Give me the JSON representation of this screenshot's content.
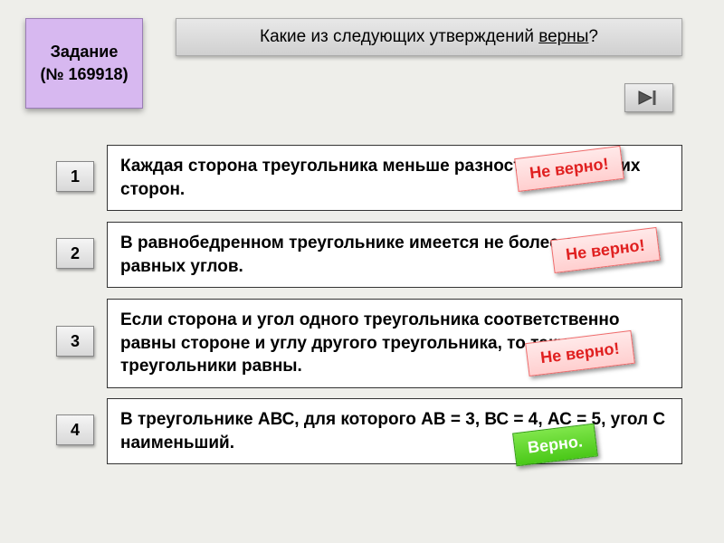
{
  "task": {
    "label": "Задание",
    "number": "(№ 169918)"
  },
  "question": {
    "prefix": "Какие из следующих утверждений ",
    "emph": "верны",
    "suffix": "?"
  },
  "statements": [
    {
      "num": "1",
      "text": "Каждая сторона треугольника меньше разности двух других сторон.",
      "tag": "Не верно!",
      "correct": false
    },
    {
      "num": "2",
      "text": "В равнобедренном треугольнике имеется не более двух равных углов.",
      "tag": "Не верно!",
      "correct": false
    },
    {
      "num": "3",
      "text": "Если сторона и угол одного треугольника соответственно равны стороне и углу другого треугольника, то такие треугольники равны.",
      "tag": "Не верно!",
      "correct": false
    },
    {
      "num": "4",
      "text": "В треугольнике АВС, для которого АВ = 3, ВС = 4, АС = 5, угол С наименьший.",
      "tag": "Верно.",
      "correct": true
    }
  ],
  "icons": {
    "next": "next-arrow"
  }
}
